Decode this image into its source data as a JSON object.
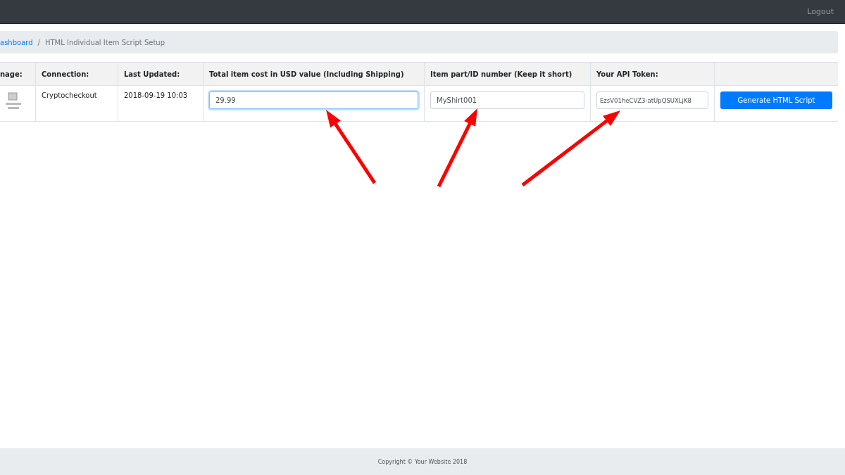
{
  "navbar": {
    "links": [
      "Logout"
    ]
  },
  "breadcrumb": [
    {
      "label": "ashboard",
      "kind": "link"
    },
    {
      "label": "/",
      "kind": "separator"
    },
    {
      "label": "HTML Individual Item Script Setup",
      "kind": "current"
    }
  ],
  "table": {
    "columns": [
      "nage:",
      "Connection:",
      "Last Updated:",
      "Total item cost in USD value (Including Shipping)",
      "Item part/ID number (Keep it short)",
      "Your API Token:"
    ],
    "rows": [
      {
        "connection": "Cryptocheckout",
        "last_updated": "2018-09-19 10:03",
        "price": {
          "value": "29.99",
          "focused": true
        },
        "item_id": {
          "value": "MyShirt001",
          "focused": false
        },
        "api_token": {
          "value": "EzsV01heCVZ3-atUpQSUXLjK8",
          "focused": false
        },
        "button": "Generate HTML Script"
      }
    ]
  },
  "footer": {
    "text": "Copyright © Your Website 2018"
  }
}
